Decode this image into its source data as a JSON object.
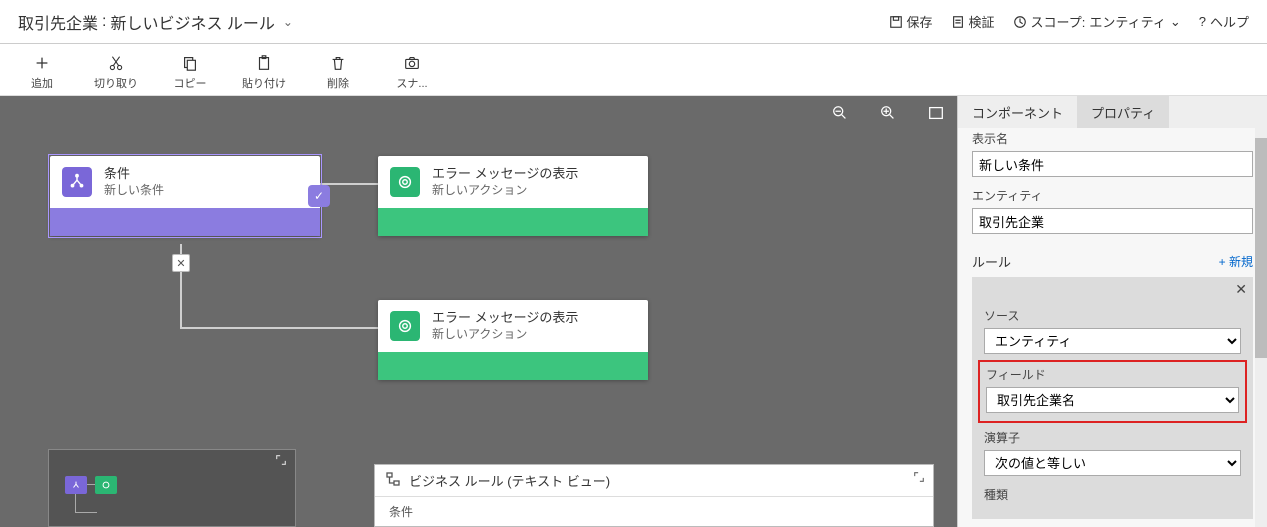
{
  "header": {
    "entity": "取引先企業",
    "rule_name": "新しいビジネス ルール",
    "actions": {
      "save": "保存",
      "validate": "検証",
      "scope_label": "スコープ:",
      "scope_value": "エンティティ",
      "help": "ヘルプ"
    }
  },
  "toolbar": {
    "add": "追加",
    "cut": "切り取り",
    "copy": "コピー",
    "paste": "貼り付け",
    "delete": "削除",
    "snapshot": "スナ..."
  },
  "canvas": {
    "condition_node": {
      "title": "条件",
      "subtitle": "新しい条件"
    },
    "action_node_1": {
      "title": "エラー メッセージの表示",
      "subtitle": "新しいアクション"
    },
    "action_node_2": {
      "title": "エラー メッセージの表示",
      "subtitle": "新しいアクション"
    },
    "textview": {
      "title": "ビジネス ルール (テキスト ビュー)",
      "section": "条件"
    }
  },
  "side": {
    "tabs": {
      "components": "コンポーネント",
      "properties": "プロパティ"
    },
    "display_name_label": "表示名",
    "display_name_value": "新しい条件",
    "entity_label": "エンティティ",
    "entity_value": "取引先企業",
    "rules_label": "ルール",
    "new_rule": "+ 新規",
    "source_label": "ソース",
    "source_value": "エンティティ",
    "field_label": "フィールド",
    "field_value": "取引先企業名",
    "operator_label": "演算子",
    "operator_value": "次の値と等しい",
    "type_label": "種類"
  }
}
